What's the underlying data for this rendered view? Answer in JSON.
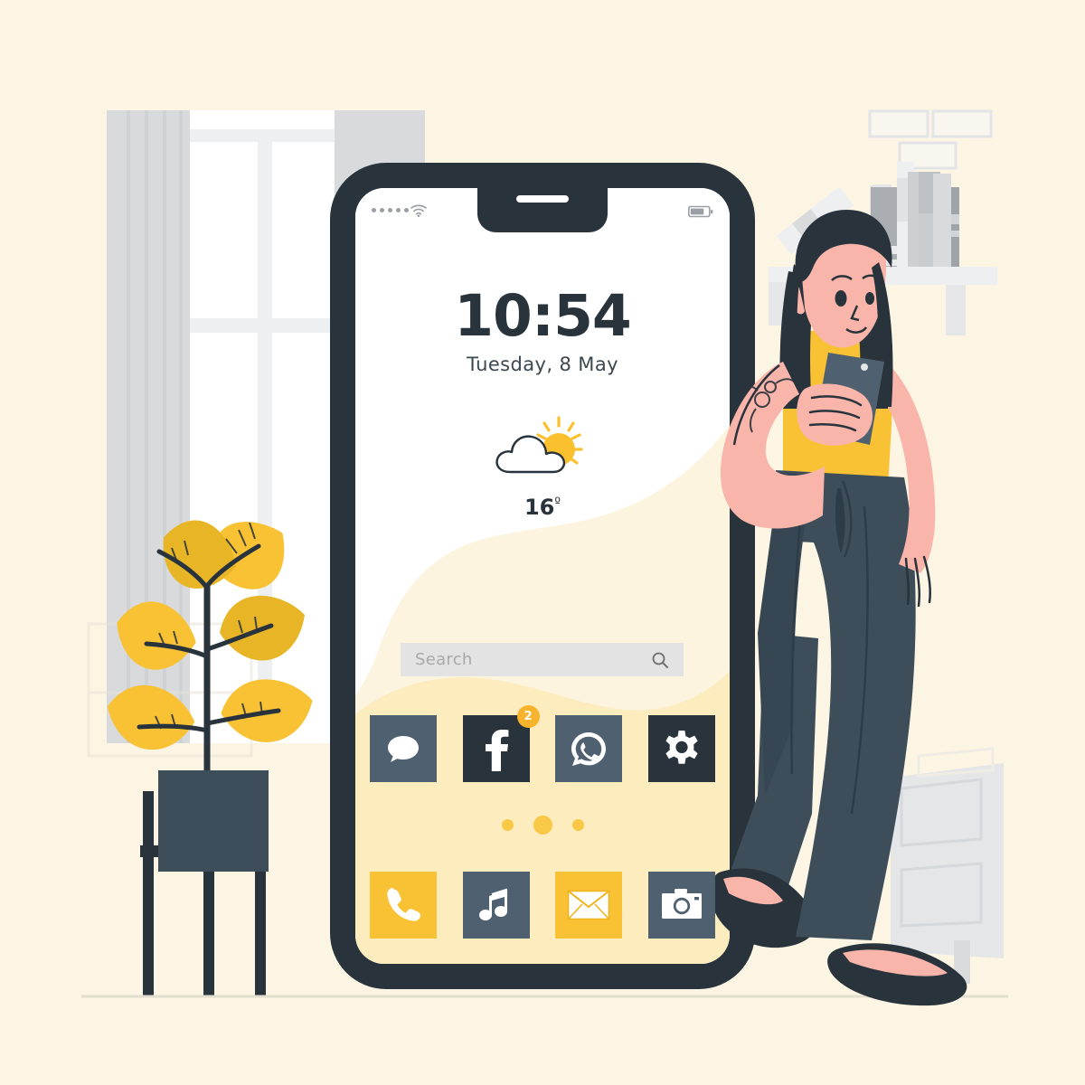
{
  "scene": {
    "title": "Phone lock screen illustration",
    "background_color": "#FDF5E3",
    "floor_line_color": "#E8E2D2"
  },
  "palette": {
    "cream_bg": "#FDF5E3",
    "wallpaper_white": "#FFFFFF",
    "wallpaper_cream": "#FDF4E0",
    "wallpaper_yellow": "#FDECBE",
    "accent_yellow": "#F9C234",
    "sun_yellow": "#FBC02D",
    "dark_slate": "#29333C",
    "mid_slate": "#4F6170",
    "skin": "#FAB5AA",
    "grey_light": "#E4E6E8",
    "grey_mid": "#C9CCCF",
    "badge_yellow": "#F7B32B"
  },
  "phone": {
    "frame_color": "#29333C",
    "statusbar": {
      "signal_icon": "signal-dots-icon",
      "signal_bars": 5,
      "wifi_icon": "wifi-icon",
      "battery_icon": "battery-icon",
      "battery_level_pct": 70,
      "notch_speaker": "speaker-pill"
    },
    "lockscreen": {
      "time": "10:54",
      "date": "Tuesday, 8 May",
      "weather": {
        "icon": "sun-behind-cloud-icon",
        "temperature": "16",
        "degree_symbol": "º"
      }
    },
    "search": {
      "placeholder": "Search",
      "value": "",
      "icon": "search-icon"
    },
    "apps": {
      "row1": [
        {
          "name": "messages",
          "icon": "chat-bubble-icon",
          "tile_color": "#4F6170",
          "glyph_color": "#FFFFFF",
          "badge": null
        },
        {
          "name": "facebook",
          "icon": "facebook-f-icon",
          "tile_color": "#29333C",
          "glyph_color": "#FFFFFF",
          "badge": "2"
        },
        {
          "name": "whatsapp",
          "icon": "whatsapp-icon",
          "tile_color": "#4F6170",
          "glyph_color": "#FFFFFF",
          "badge": null
        },
        {
          "name": "settings",
          "icon": "gear-icon",
          "tile_color": "#29333C",
          "glyph_color": "#FFFFFF",
          "badge": null
        }
      ],
      "row2": [
        {
          "name": "phone",
          "icon": "phone-handset-icon",
          "tile_color": "#F9C234",
          "glyph_color": "#FFFFFF",
          "badge": null
        },
        {
          "name": "music",
          "icon": "music-note-icon",
          "tile_color": "#4F6170",
          "glyph_color": "#FFFFFF",
          "badge": null
        },
        {
          "name": "mail",
          "icon": "envelope-icon",
          "tile_color": "#F9C234",
          "glyph_color": "#FFFFFF",
          "badge": null
        },
        {
          "name": "camera",
          "icon": "camera-icon",
          "tile_color": "#4F6170",
          "glyph_color": "#FFFFFF",
          "badge": null
        }
      ]
    },
    "pager": {
      "dots": 3,
      "active_index": 1,
      "dot_color": "#F9C846"
    }
  },
  "room": {
    "window": {
      "frame_color": "#FFFFFF",
      "pane_color": "#FFFFFF",
      "curtain_color": "#D8DADC"
    },
    "plant": {
      "leaf_color": "#F9C234",
      "leaf_color_alt": "#E3AF22",
      "stem_color": "#29333C",
      "pot_color": "#3D4D59",
      "stand_color": "#29333C",
      "leaf_count": 6
    },
    "shelf": {
      "color": "#EDEFF1",
      "book_count": 6
    },
    "frames": {
      "count": 4,
      "color": "#F6F4EC",
      "border_color": "#E2E4E7"
    },
    "cabinet": {
      "color": "#E4E6E8",
      "drawer_count": 2
    }
  },
  "person": {
    "hair_color": "#29333C",
    "skin_color": "#FAB5AA",
    "top_color": "#F9C234",
    "trousers_color": "#3D4D59",
    "shoe_color": "#29333C",
    "held_phone_color": "#4F6170",
    "tattoo": "floral-tattoo"
  }
}
